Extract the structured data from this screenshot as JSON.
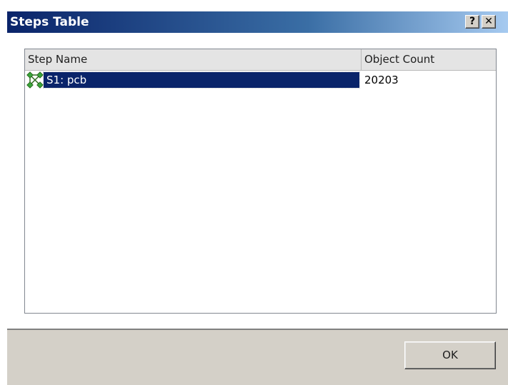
{
  "window": {
    "title": "Steps Table",
    "help_label": "?",
    "close_label": "✕"
  },
  "table": {
    "columns": [
      "Step Name",
      "Object Count"
    ],
    "rows": [
      {
        "name": "S1: pcb",
        "count": "20203",
        "icon": "step-network-icon",
        "selected": true
      }
    ]
  },
  "footer": {
    "ok_label": "OK"
  },
  "colors": {
    "title_gradient_start": "#0a246a",
    "title_gradient_end": "#a6caf0",
    "selection": "#0a246a",
    "dialog_face": "#d4d0c8",
    "icon_green": "#3aa53a"
  }
}
